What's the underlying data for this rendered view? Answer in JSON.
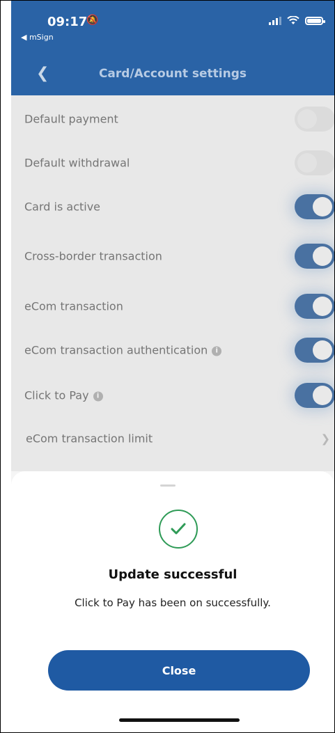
{
  "status_bar": {
    "time": "09:17",
    "back_app": "◀ mSign"
  },
  "nav": {
    "title": "Card/Account settings"
  },
  "settings": [
    {
      "label": "Default payment",
      "toggle": "off",
      "info": false
    },
    {
      "label": "Default withdrawal",
      "toggle": "off",
      "info": false
    },
    {
      "label": "Card is active",
      "toggle": "on",
      "info": false
    },
    {
      "label": "Cross-border transaction",
      "toggle": "on",
      "info": false
    },
    {
      "label": "eCom transaction",
      "toggle": "on",
      "info": false
    },
    {
      "label": "eCom transaction authentication",
      "toggle": "on",
      "info": true
    },
    {
      "label": "Click to Pay",
      "toggle": "on",
      "info": true
    },
    {
      "label": "eCom transaction limit",
      "toggle": "none",
      "info": false
    }
  ],
  "sheet": {
    "title": "Update successful",
    "message": "Click to Pay has been on successfully.",
    "close_label": "Close"
  },
  "colors": {
    "nav_blue": "#2a63a6",
    "toggle_on": "#4d76a8",
    "success_green": "#2f9b57",
    "button_blue": "#1f5aa3"
  }
}
